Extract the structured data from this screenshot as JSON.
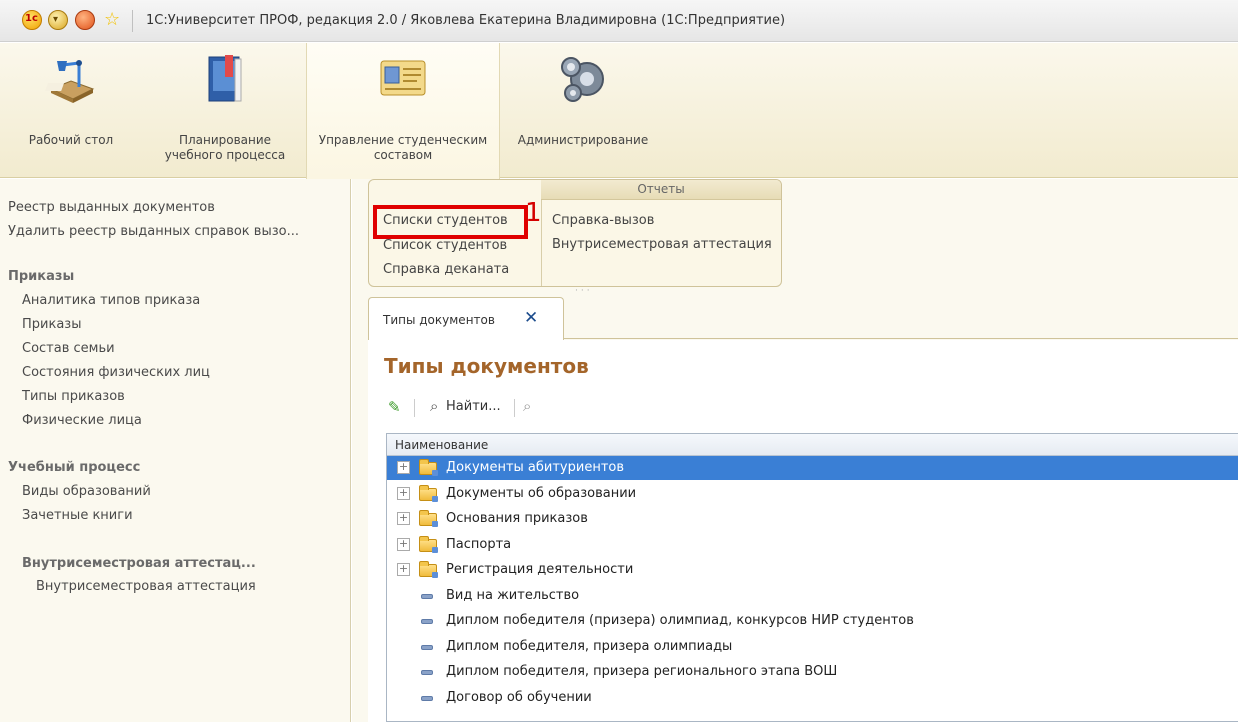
{
  "window": {
    "title": "1С:Университет ПРОФ, редакция 2.0 / Яковлева Екатерина Владимировна  (1С:Предприятие)"
  },
  "sections": [
    {
      "label": "Рабочий стол",
      "icon": "desk-lamp-icon"
    },
    {
      "label": "Планирование учебного процесса",
      "icon": "book-icon"
    },
    {
      "label": "Управление студенческим составом",
      "icon": "id-card-icon"
    },
    {
      "label": "Администрирование",
      "icon": "gears-icon"
    }
  ],
  "leftnav": {
    "top_links": [
      "Реестр выданных документов",
      "Удалить реестр выданных справок вызо..."
    ],
    "groups": [
      {
        "title": "Приказы",
        "items": [
          "Аналитика типов приказа",
          "Приказы",
          "Состав семьи",
          "Состояния физических лиц",
          "Типы приказов",
          "Физические лица"
        ]
      },
      {
        "title": "Учебный процесс",
        "items": [
          "Виды образований",
          "Зачетные книги"
        ]
      },
      {
        "title": "Внутрисеместровая аттестац...",
        "items": [
          "Внутрисеместровая аттестация"
        ]
      }
    ]
  },
  "commands": {
    "left_items": [
      "Списки студентов",
      "Список студентов",
      "Справка деканата"
    ],
    "reports_title": "Отчеты",
    "report_items": [
      "Справка-вызов",
      "Внутрисеместровая аттестация"
    ],
    "annotation_number": "1",
    "annotation_color": "#e00000"
  },
  "tab": {
    "label": "Типы документов",
    "close_glyph": "✕"
  },
  "form": {
    "title": "Типы документов",
    "find_label": "Найти...",
    "column_header": "Наименование",
    "rows": [
      {
        "text": "Документы абитуриентов",
        "type": "folder",
        "selected": true
      },
      {
        "text": "Документы об образовании",
        "type": "folder",
        "selected": false
      },
      {
        "text": "Основания приказов",
        "type": "folder",
        "selected": false
      },
      {
        "text": "Паспорта",
        "type": "folder",
        "selected": false
      },
      {
        "text": "Регистрация деятельности",
        "type": "folder",
        "selected": false
      },
      {
        "text": "Вид на жительство",
        "type": "item",
        "selected": false
      },
      {
        "text": "Диплом победителя (призера) олимпиад, конкурсов НИР студентов",
        "type": "item",
        "selected": false
      },
      {
        "text": "Диплом победителя, призера олимпиады",
        "type": "item",
        "selected": false
      },
      {
        "text": "Диплом победителя, призера регионального этапа ВОШ",
        "type": "item",
        "selected": false
      },
      {
        "text": "Договор об обучении",
        "type": "item",
        "selected": false
      }
    ]
  }
}
